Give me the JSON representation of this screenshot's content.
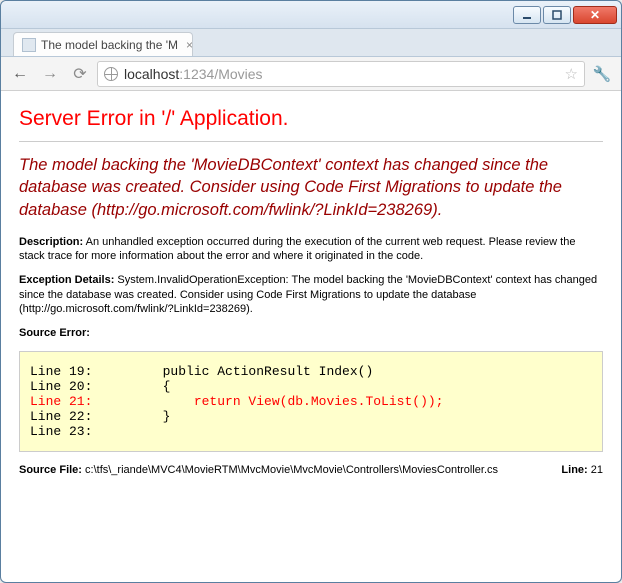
{
  "window": {
    "tab_title": "The model backing the 'M",
    "url_host": "localhost",
    "url_port": ":1234",
    "url_path": "/Movies"
  },
  "error": {
    "heading": "Server Error in '/' Application.",
    "subheading": "The model backing the 'MovieDBContext' context has changed since the database was created. Consider using Code First Migrations to update the database (http://go.microsoft.com/fwlink/?LinkId=238269).",
    "description_label": "Description:",
    "description_text": " An unhandled exception occurred during the execution of the current web request. Please review the stack trace for more information about the error and where it originated in the code.",
    "exception_label": "Exception Details:",
    "exception_text": " System.InvalidOperationException: The model backing the 'MovieDBContext' context has changed since the database was created. Consider using Code First Migrations to update the database (http://go.microsoft.com/fwlink/?LinkId=238269).",
    "source_error_label": "Source Error:",
    "code": {
      "l19": "Line 19:         public ActionResult Index()",
      "l20": "Line 20:         {",
      "l21": "Line 21:             return View(db.Movies.ToList());",
      "l22": "Line 22:         }",
      "l23": "Line 23:"
    },
    "source_file_label": "Source File:",
    "source_file": " c:\\tfs\\_riande\\MVC4\\MovieRTM\\MvcMovie\\MvcMovie\\Controllers\\MoviesController.cs",
    "line_label": "Line:",
    "line_number": " 21"
  }
}
